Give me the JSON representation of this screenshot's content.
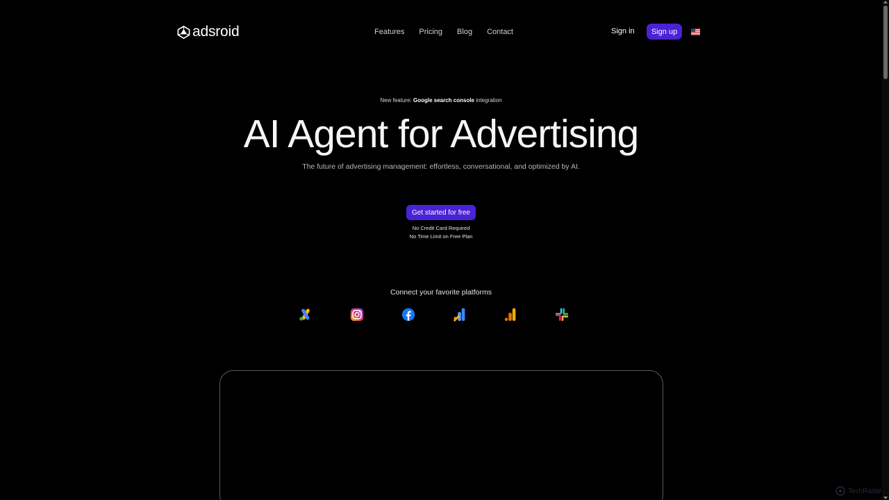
{
  "header": {
    "logo_text": "adsroid",
    "nav": [
      "Features",
      "Pricing",
      "Blog",
      "Contact"
    ],
    "signin_label": "Sign in",
    "signup_label": "Sign up",
    "language_flag": "us-flag-icon"
  },
  "hero": {
    "badge_prefix": "New feature: ",
    "badge_bold": "Google search console",
    "badge_suffix": " integration",
    "title": "AI Agent for Advertising",
    "subtitle": "The future of advertising management: effortless, conversational, and optimized by AI.",
    "cta_label": "Get started for free",
    "notes": [
      "No Credit Card Required",
      "No Time Limit on Free Plan"
    ]
  },
  "platforms": {
    "title": "Connect your favorite platforms",
    "icons": [
      "google-ads-icon",
      "instagram-icon",
      "facebook-icon",
      "google-analytics-icon",
      "google-analytics-bars-icon",
      "slack-icon"
    ]
  },
  "watermark": {
    "text": "TechRadar"
  },
  "colors": {
    "background": "#000000",
    "accent": "#4a22d6",
    "text": "#ffffff",
    "muted": "#b8b8b8"
  }
}
